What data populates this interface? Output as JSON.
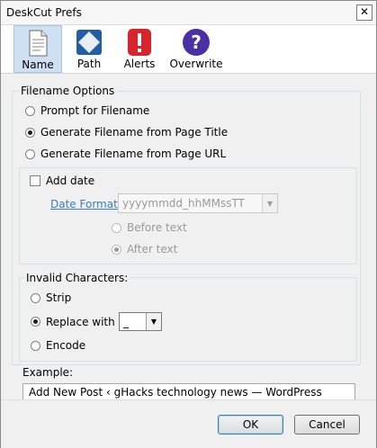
{
  "window": {
    "title": "DeskCut Prefs",
    "close": "✕"
  },
  "toolbar": {
    "items": [
      {
        "label": "Name",
        "icon": "document-icon",
        "selected": true
      },
      {
        "label": "Path",
        "icon": "diamond-icon",
        "selected": false
      },
      {
        "label": "Alerts",
        "icon": "warning-icon",
        "selected": false
      },
      {
        "label": "Overwrite",
        "icon": "question-icon",
        "selected": false
      }
    ]
  },
  "filename_options": {
    "title": "Filename Options",
    "choices": [
      {
        "label": "Prompt for Filename",
        "checked": false
      },
      {
        "label": "Generate Filename from Page Title",
        "checked": true
      },
      {
        "label": "Generate Filename from Page URL",
        "checked": false
      }
    ],
    "add_date": {
      "label": "Add date",
      "checked": false
    },
    "date_format": {
      "label": "Date Format",
      "value": "yyyymmdd_hhMMssTT"
    },
    "date_position": [
      {
        "label": "Before text",
        "checked": false
      },
      {
        "label": "After text",
        "checked": true
      }
    ]
  },
  "invalid_characters": {
    "title": "Invalid Characters:",
    "choices": [
      {
        "label": "Strip",
        "checked": false
      },
      {
        "label": "Replace with",
        "checked": true
      },
      {
        "label": "Encode",
        "checked": false
      }
    ],
    "replacement": "_"
  },
  "example": {
    "title": "Example:",
    "text": "Add New Post ‹ gHacks technology news — WordPress"
  },
  "buttons": {
    "ok": "OK",
    "cancel": "Cancel"
  },
  "colors": {
    "accent": "#3a7fc0",
    "selected_bg": "#cfe0f3"
  }
}
